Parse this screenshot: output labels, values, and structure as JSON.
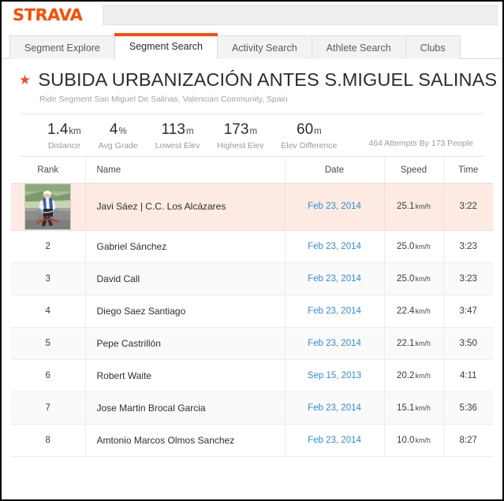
{
  "brand": {
    "logo_text": "STRAVA",
    "accent_color": "#fc4c02"
  },
  "tabs": [
    {
      "label": "Segment Explore",
      "active": false
    },
    {
      "label": "Segment Search",
      "active": true
    },
    {
      "label": "Activity Search",
      "active": false
    },
    {
      "label": "Athlete Search",
      "active": false
    },
    {
      "label": "Clubs",
      "active": false
    }
  ],
  "segment": {
    "star_icon": "star-icon",
    "title": "SUBIDA URBANIZACIÓN ANTES S.MIGUEL SALINAS",
    "subtitle": "Ride Segment San Miguel De Salinas, Valencian Community, Spain",
    "attempts_text": "464 Attempts By 173 People"
  },
  "stats": [
    {
      "value": "1.4",
      "unit": "km",
      "label": "Distance"
    },
    {
      "value": "4",
      "unit": "%",
      "label": "Avg Grade"
    },
    {
      "value": "113",
      "unit": "m",
      "label": "Lowest Elev"
    },
    {
      "value": "173",
      "unit": "m",
      "label": "Highest Elev"
    },
    {
      "value": "60",
      "unit": "m",
      "label": "Elev Difference"
    }
  ],
  "leaderboard": {
    "columns": [
      "Rank",
      "Name",
      "Date",
      "Speed",
      "Time"
    ],
    "rows": [
      {
        "rank": "",
        "has_avatar": true,
        "avatar_name": "cyclist-photo-avatar",
        "name": "Javi Sáez | C.C. Los Alcázares",
        "date": "Feb 23, 2014",
        "speed": "25.1",
        "speed_unit": "km/h",
        "time": "3:22",
        "highlighted": true
      },
      {
        "rank": "2",
        "has_avatar": false,
        "name": "Gabriel Sánchez",
        "date": "Feb 23, 2014",
        "speed": "25.0",
        "speed_unit": "km/h",
        "time": "3:23",
        "highlighted": false
      },
      {
        "rank": "3",
        "has_avatar": false,
        "name": "David Call",
        "date": "Feb 23, 2014",
        "speed": "25.0",
        "speed_unit": "km/h",
        "time": "3:23",
        "highlighted": false
      },
      {
        "rank": "4",
        "has_avatar": false,
        "name": "Diego Saez Santiago",
        "date": "Feb 23, 2014",
        "speed": "22.4",
        "speed_unit": "km/h",
        "time": "3:47",
        "highlighted": false
      },
      {
        "rank": "5",
        "has_avatar": false,
        "name": "Pepe Castrillón",
        "date": "Feb 23, 2014",
        "speed": "22.1",
        "speed_unit": "km/h",
        "time": "3:50",
        "highlighted": false
      },
      {
        "rank": "6",
        "has_avatar": false,
        "name": "Robert Waite",
        "date": "Sep 15, 2013",
        "speed": "20.2",
        "speed_unit": "km/h",
        "time": "4:11",
        "highlighted": false
      },
      {
        "rank": "7",
        "has_avatar": false,
        "name": "Jose Martin Brocal Garcia",
        "date": "Feb 23, 2014",
        "speed": "15.1",
        "speed_unit": "km/h",
        "time": "5:36",
        "highlighted": false
      },
      {
        "rank": "8",
        "has_avatar": false,
        "name": "Amtonio Marcos Olmos Sanchez",
        "date": "Feb 23, 2014",
        "speed": "10.0",
        "speed_unit": "km/h",
        "time": "8:27",
        "highlighted": false
      }
    ]
  }
}
